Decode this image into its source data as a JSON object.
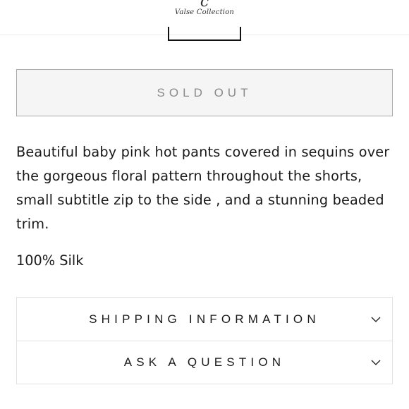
{
  "header": {
    "logo_mark": "c",
    "logo_text": "Valse Collection"
  },
  "product": {
    "sold_out_label": "SOLD OUT",
    "description": "Beautiful baby pink hot pants covered in sequins over the gorgeous floral pattern throughout the shorts, small subtitle zip to the side , and a stunning beaded trim.",
    "material": "100% Silk"
  },
  "accordion": {
    "items": [
      {
        "label": "SHIPPING INFORMATION",
        "icon": "chevron-down-icon"
      },
      {
        "label": "ASK A QUESTION",
        "icon": "chevron-down-icon"
      }
    ]
  }
}
